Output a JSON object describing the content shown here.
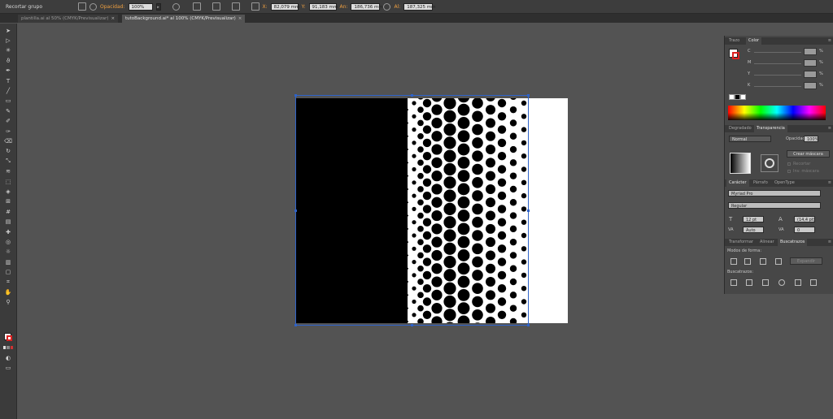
{
  "controlbar": {
    "group_label": "Recortar grupo",
    "opacity_label": "Opacidad:",
    "opacity_value": "100%",
    "x_label": "X:",
    "x_value": "82,079 mm",
    "y_label": "Y:",
    "y_value": "91,183 mm",
    "w_label": "An:",
    "w_value": "186,736 mm",
    "h_label": "Al:",
    "h_value": "187,325 mm"
  },
  "tabs": [
    {
      "label": "plantilla.ai al 50% (CMYK/Previsualizar)"
    },
    {
      "label": "tutoBackground.ai* al 100% (CMYK/Previsualizar)"
    }
  ],
  "tab_close": "×",
  "tools": [
    "selection-tool",
    "direct-selection-tool",
    "magic-wand-tool",
    "lasso-tool",
    "pen-tool",
    "type-tool",
    "line-tool",
    "rectangle-tool",
    "paintbrush-tool",
    "pencil-tool",
    "blob-brush-tool",
    "eraser-tool",
    "rotate-tool",
    "scale-tool",
    "width-tool",
    "free-transform-tool",
    "shape-builder-tool",
    "perspective-grid-tool",
    "mesh-tool",
    "gradient-tool",
    "eyedropper-tool",
    "blend-tool",
    "symbol-sprayer-tool",
    "column-graph-tool",
    "artboard-tool",
    "slice-tool",
    "hand-tool",
    "zoom-tool"
  ],
  "panels": {
    "color": {
      "tabs": [
        "Trazo",
        "Color"
      ],
      "channels": [
        {
          "label": "C",
          "unit": "%"
        },
        {
          "label": "M",
          "unit": "%"
        },
        {
          "label": "Y",
          "unit": "%"
        },
        {
          "label": "K",
          "unit": "%"
        }
      ]
    },
    "transparency": {
      "tabs": [
        "Degradado",
        "Transparencia"
      ],
      "blend_mode": "Normal",
      "opacity_label": "Opacidad:",
      "opacity_value": "100%",
      "make_mask_button": "Crear máscara",
      "clip_label": "Recortar",
      "invert_label": "Inv. máscara"
    },
    "character": {
      "tabs": [
        "Carácter",
        "Párrafo",
        "OpenType"
      ],
      "font_family": "Myriad Pro",
      "font_style": "Regular",
      "font_size": "12 pt",
      "leading": "(14,4 pt)",
      "kerning": "Auto",
      "tracking": "0"
    },
    "pathfinder": {
      "tabs": [
        "Transformar",
        "Alinear",
        "Buscatrazos"
      ],
      "shape_modes_label": "Modos de forma:",
      "expand_button": "Expandir",
      "pathfinders_label": "Buscatrazos:"
    }
  },
  "colors": {
    "app_bg": "#535353",
    "panel_bg": "#474747",
    "selection": "#2f63c9",
    "artwork": "#000000"
  }
}
